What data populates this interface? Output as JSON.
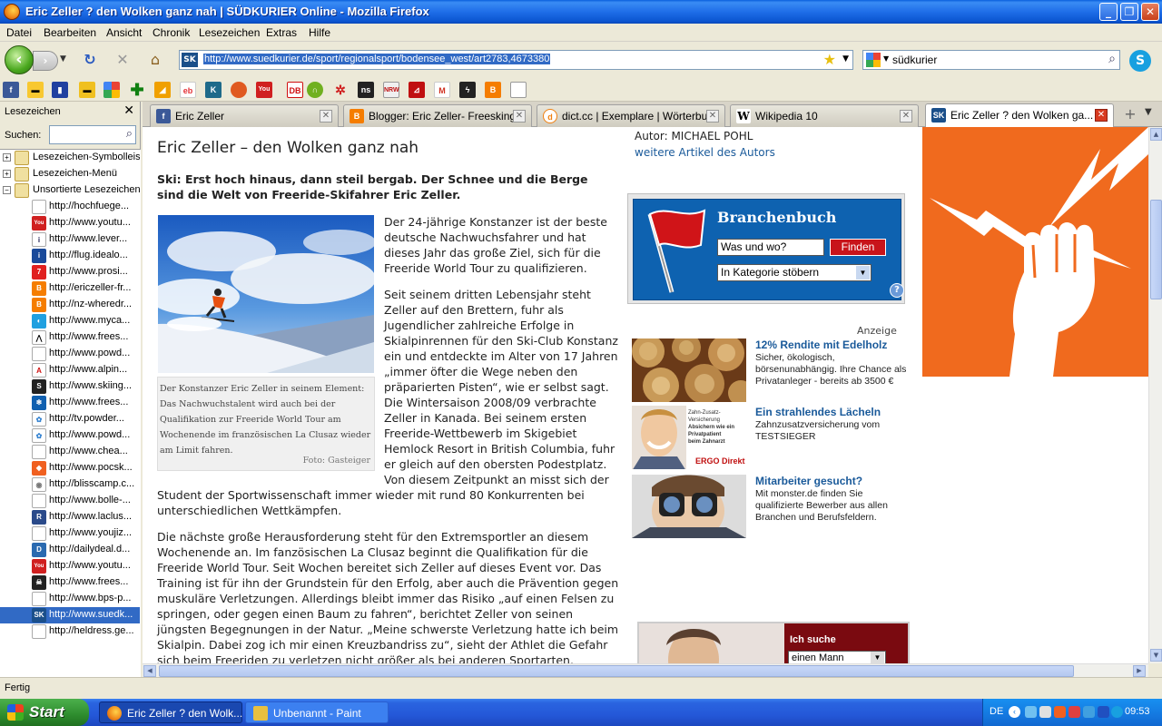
{
  "window": {
    "title": "Eric Zeller ? den Wolken ganz nah | SÜDKURIER Online - Mozilla Firefox",
    "minimize": "_",
    "maximize": "❐",
    "close": "✕"
  },
  "menu": [
    "Datei",
    "Bearbeiten",
    "Ansicht",
    "Chronik",
    "Lesezeichen",
    "Extras",
    "Hilfe"
  ],
  "nav": {
    "url": "http://www.suedkurier.de/sport/regionalsport/bodensee_west/art2783,4673380",
    "site_badge": "SK",
    "search_value": "südkurier"
  },
  "sidebar": {
    "title": "Lesezeichen",
    "search_label": "Suchen:",
    "folders": [
      "Lesezeichen-Symbolleiste",
      "Lesezeichen-Menü",
      "Unsortierte Lesezeichen"
    ],
    "items": [
      {
        "label": "http://hochfuege...",
        "icon": "page-icon"
      },
      {
        "label": "http://www.youtu...",
        "icon": "youtube-icon"
      },
      {
        "label": "http://www.lever...",
        "icon": "info-icon"
      },
      {
        "label": "http://flug.idealo...",
        "icon": "idealo-icon"
      },
      {
        "label": "http://www.prosi...",
        "icon": "prosieben-icon"
      },
      {
        "label": "http://ericzeller-fr...",
        "icon": "blogger-icon"
      },
      {
        "label": "http://nz-wheredr...",
        "icon": "blogger-icon"
      },
      {
        "label": "http://www.myca...",
        "icon": "mycamera-icon"
      },
      {
        "label": "http://www.frees...",
        "icon": "mountain-icon"
      },
      {
        "label": "http://www.powd...",
        "icon": "page-icon"
      },
      {
        "label": "http://www.alpin...",
        "icon": "alpin-icon"
      },
      {
        "label": "http://www.skiing...",
        "icon": "skiing-icon"
      },
      {
        "label": "http://www.frees...",
        "icon": "snowflake-icon"
      },
      {
        "label": "http://tv.powder...",
        "icon": "flower-icon"
      },
      {
        "label": "http://www.powd...",
        "icon": "flower-icon"
      },
      {
        "label": "http://www.chea...",
        "icon": "page-icon"
      },
      {
        "label": "http://www.pocsk...",
        "icon": "poc-icon"
      },
      {
        "label": "http://blisscamp.c...",
        "icon": "bliss-icon"
      },
      {
        "label": "http://www.bolle-...",
        "icon": "page-icon"
      },
      {
        "label": "http://www.laclus...",
        "icon": "laclusaz-icon"
      },
      {
        "label": "http://www.youjiz...",
        "icon": "page-icon"
      },
      {
        "label": "http://dailydeal.d...",
        "icon": "dailydeal-icon"
      },
      {
        "label": "http://www.youtu...",
        "icon": "youtube-icon"
      },
      {
        "label": "http://www.frees...",
        "icon": "skull-icon"
      },
      {
        "label": "http://www.bps-p...",
        "icon": "page-icon"
      },
      {
        "label": "http://www.suedk...",
        "icon": "suedkurier-icon"
      },
      {
        "label": "http://heldress.ge...",
        "icon": "page-icon"
      }
    ]
  },
  "tabs": [
    {
      "label": "Eric Zeller",
      "icon": "facebook-icon"
    },
    {
      "label": "Blogger: Eric Zeller- Freesking -...",
      "icon": "blogger-icon"
    },
    {
      "label": "dict.cc | Exemplare | Wörterbuc...",
      "icon": "dictcc-icon"
    },
    {
      "label": "Wikipedia 10",
      "icon": "wikipedia-icon"
    },
    {
      "label": "Eric Zeller ? den Wolken ga...",
      "icon": "suedkurier-icon"
    }
  ],
  "article": {
    "title": "Eric Zeller – den Wolken ganz nah",
    "lead": "Ski: Erst hoch hinaus, dann steil bergab. Der Schnee und die Berge sind die Welt von Freeride-Skifahrer Eric Zeller.",
    "caption": "Der Konstanzer Eric Zeller in seinem Element: Das Nachwuchstalent wird auch bei der Qualifikation zur Freeride World Tour am Wochenende im französischen La Clusaz wieder am Limit fahren.",
    "credit": "Foto: Gasteiger",
    "p1": [
      "Der 24-jährige Konstanzer ist der beste",
      "deutsche Nachwuchsfahrer und hat",
      "dieses Jahr das große Ziel, sich für die",
      "Freeride World Tour zu qualifizieren."
    ],
    "p2": [
      "Seit seinem dritten Lebensjahr steht",
      "Zeller auf den Brettern, fuhr als",
      "Jugendlicher zahlreiche Erfolge in",
      "Skialpinrennen für den Ski-Club Konstanz",
      "ein und entdeckte im Alter von 17 Jahren",
      "„immer öfter die Wege neben den",
      "präparierten Pisten“, wie er selbst sagt.",
      "Die Wintersaison 2008/09 verbrachte",
      "Zeller in Kanada. Bei seinem ersten",
      "Freeride-Wettbewerb im Skigebiet",
      "Hemlock Resort in British Columbia, fuhr",
      "er gleich auf den obersten Podestplatz.",
      "Von diesem Zeitpunkt an misst sich der"
    ],
    "p2_full": [
      "Student der Sportwissenschaft immer wieder mit rund 80 Konkurrenten bei",
      "unterschiedlichen Wettkämpfen."
    ],
    "p3": [
      "Die nächste große Herausforderung steht für den Extremsportler an diesem",
      "Wochenende an. Im fanzösischen La Clusaz beginnt die Qualifikation für die",
      "Freeride World Tour. Seit Wochen bereitet sich Zeller auf dieses Event vor. Das",
      "Training ist für ihn der Grundstein für den Erfolg, aber auch die Prävention gegen",
      "muskuläre Verletzungen. Allerdings bleibt immer das Risiko „auf einen Felsen zu",
      "springen, oder gegen einen Baum zu fahren“, berichtet Zeller von seinen",
      "jüngsten Begegnungen in der Natur. „Meine schwerste Verletzung hatte ich beim",
      "Skialpin. Dabei zog ich mir einen Kreuzbandriss zu“, sieht der Athlet die Gefahr",
      "sich beim Freeriden zu verletzen nicht größer als bei anderen Sportarten."
    ]
  },
  "author": {
    "name": "Autor: MICHAEL POHL",
    "link": "weitere Artikel des Autors"
  },
  "branchenbuch": {
    "title": "Branchenbuch",
    "input_value": "Was und wo?",
    "button": "Finden",
    "select_value": "In Kategorie stöbern",
    "help": "?"
  },
  "ads": {
    "label": "Anzeige",
    "items": [
      {
        "title": "12% Rendite mit Edelholz",
        "text": "Sicher, ökologisch, börsenunabhängig. Ihre Chance als Privatanleger - bereits ab 3500 €"
      },
      {
        "title": "Ein strahlendes Lächeln",
        "text": "Zahnzusatzversicherung vom TESTSIEGER"
      },
      {
        "title": "Mitarbeiter gesucht?",
        "text": "Mit monster.de finden Sie qualifizierte Bewerber aus allen Branchen und Berufsfeldern."
      }
    ],
    "ergo_lines": [
      "Zahn-Zusatz-Versicherung",
      "Absichern wie ein",
      "Privatpatient",
      "beim Zahnarzt",
      "ERGO Direkt"
    ],
    "bottom_title": "Ich suche",
    "bottom_select": "einen Mann"
  },
  "status": "Fertig",
  "taskbar": {
    "start": "Start",
    "tasks": [
      "Eric Zeller ? den Wolk...",
      "Unbenannt - Paint"
    ],
    "lang": "DE",
    "clock": "09:53"
  }
}
